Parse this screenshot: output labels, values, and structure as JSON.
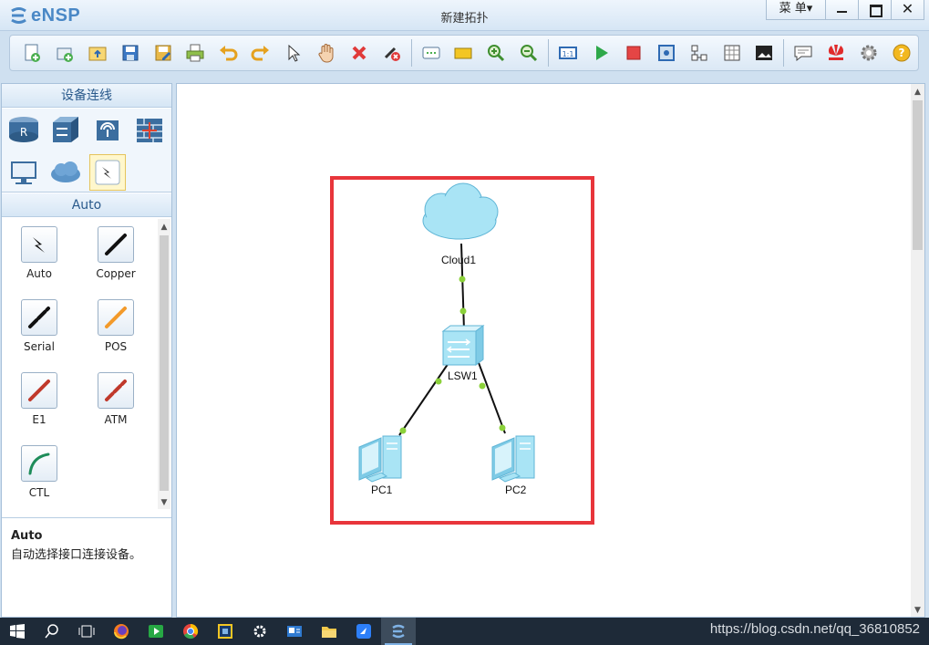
{
  "window": {
    "app_name": "eNSP",
    "title": "新建拓扑",
    "menu_label": "菜 单▾",
    "close_glyph": "✕"
  },
  "toolbar": {
    "buttons": [
      "new-topology",
      "new-lab",
      "open",
      "save",
      "save-as",
      "print",
      "undo",
      "redo",
      "select",
      "pan",
      "delete",
      "delete-links",
      "text",
      "palette",
      "zoom-in",
      "zoom-out",
      "fit",
      "start-devices",
      "stop-devices",
      "capture",
      "topology-view",
      "grid",
      "screenshot",
      "chat",
      "huawei",
      "settings",
      "help"
    ]
  },
  "left_panel": {
    "header": "设备连线",
    "device_categories": [
      "router-icon",
      "switch-icon",
      "wireless-icon",
      "firewall-icon",
      "pc-icon",
      "cloud-icon",
      "cable-icon"
    ],
    "selected_category": "cable-icon",
    "subheader": "Auto",
    "cables": [
      {
        "label": "Auto",
        "color": "#000000"
      },
      {
        "label": "Copper",
        "color": "#000000"
      },
      {
        "label": "Serial",
        "color": "#000000"
      },
      {
        "label": "POS",
        "color": "#f39a2a"
      },
      {
        "label": "E1",
        "color": "#c0392b"
      },
      {
        "label": "ATM",
        "color": "#c0392b"
      },
      {
        "label": "CTL",
        "color": "#1e8c5a"
      }
    ],
    "description": {
      "title": "Auto",
      "text": "自动选择接口连接设备。"
    }
  },
  "topology": {
    "nodes": [
      {
        "id": "Cloud1",
        "label": "Cloud1",
        "type": "cloud"
      },
      {
        "id": "LSW1",
        "label": "LSW1",
        "type": "switch"
      },
      {
        "id": "PC1",
        "label": "PC1",
        "type": "pc"
      },
      {
        "id": "PC2",
        "label": "PC2",
        "type": "pc"
      }
    ],
    "links": [
      {
        "from": "Cloud1",
        "to": "LSW1",
        "status": "up"
      },
      {
        "from": "LSW1",
        "to": "PC1",
        "status": "up"
      },
      {
        "from": "LSW1",
        "to": "PC2",
        "status": "up"
      }
    ],
    "link_up_color": "#8bd13a",
    "highlight_color": "#e8353b"
  },
  "taskbar": {
    "apps": [
      "windows-start",
      "search",
      "task-view",
      "firefox",
      "media",
      "chrome",
      "virtualbox",
      "settings",
      "remote",
      "explorer",
      "feishu",
      "ensp"
    ],
    "active": "ensp",
    "watermark": "https://blog.csdn.net/qq_36810852"
  }
}
